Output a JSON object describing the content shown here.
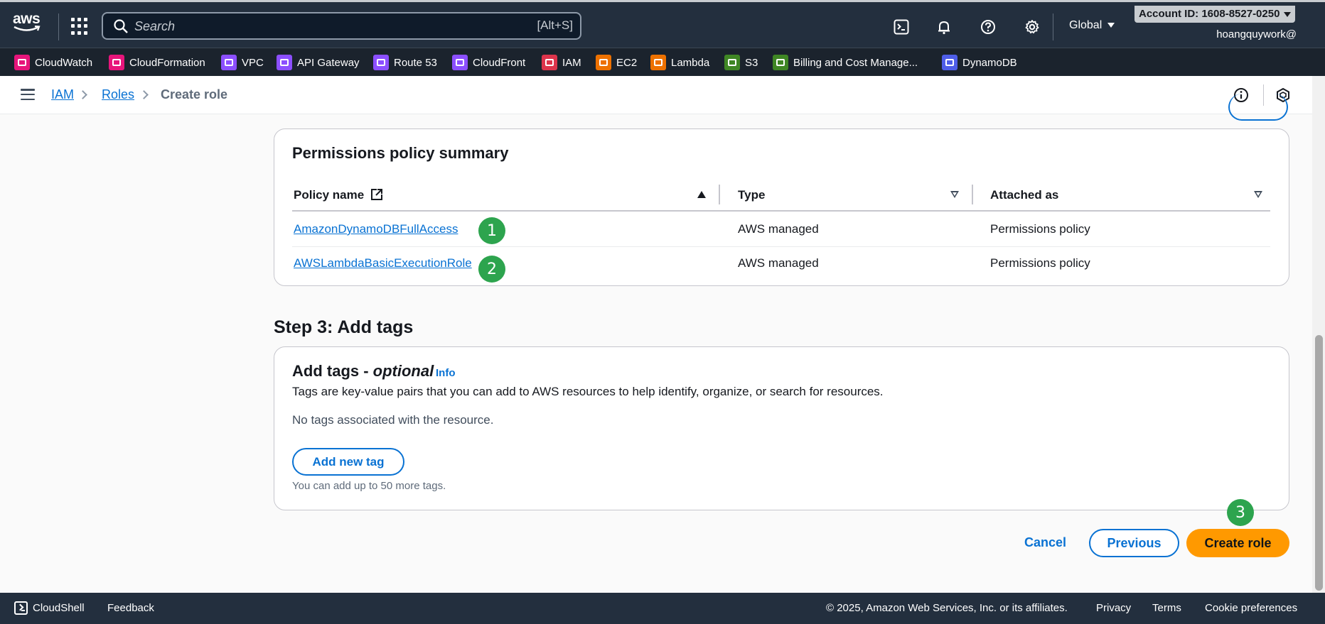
{
  "topnav": {
    "search_placeholder": "Search",
    "search_shortcut": "[Alt+S]",
    "region": "Global",
    "account": "Account ID: 1608-8527-0250",
    "username": "hoangquywork@"
  },
  "favorites": [
    {
      "label": "CloudWatch",
      "color": "#e7157b"
    },
    {
      "label": "CloudFormation",
      "color": "#e7157b"
    },
    {
      "label": "VPC",
      "color": "#8c4fff"
    },
    {
      "label": "API Gateway",
      "color": "#8c4fff"
    },
    {
      "label": "Route 53",
      "color": "#8c4fff"
    },
    {
      "label": "CloudFront",
      "color": "#8c4fff"
    },
    {
      "label": "IAM",
      "color": "#dd344c"
    },
    {
      "label": "EC2",
      "color": "#ed7100"
    },
    {
      "label": "Lambda",
      "color": "#ed7100"
    },
    {
      "label": "S3",
      "color": "#3f8624"
    },
    {
      "label": "Billing and Cost Manage...",
      "color": "#3f8624"
    },
    {
      "label": "DynamoDB",
      "color": "#4f5ee8"
    }
  ],
  "breadcrumb": {
    "items": [
      "IAM",
      "Roles"
    ],
    "current": "Create role"
  },
  "permissions": {
    "title": "Permissions policy summary",
    "columns": [
      "Policy name",
      "Type",
      "Attached as"
    ],
    "rows": [
      {
        "name": "AmazonDynamoDBFullAccess",
        "type": "AWS managed",
        "attached": "Permissions policy",
        "marker": "1"
      },
      {
        "name": "AWSLambdaBasicExecutionRole",
        "type": "AWS managed",
        "attached": "Permissions policy",
        "marker": "2"
      }
    ]
  },
  "step3": {
    "title": "Step 3: Add tags",
    "card_title": "Add tags - ",
    "card_title_em": "optional",
    "info": "Info",
    "description": "Tags are key-value pairs that you can add to AWS resources to help identify, organize, or search for resources.",
    "empty": "No tags associated with the resource.",
    "add_button": "Add new tag",
    "hint": "You can add up to 50 more tags."
  },
  "actions": {
    "cancel": "Cancel",
    "previous": "Previous",
    "create": "Create role",
    "marker": "3"
  },
  "footer": {
    "cloudshell": "CloudShell",
    "feedback": "Feedback",
    "copyright": "© 2025, Amazon Web Services, Inc. or its affiliates.",
    "privacy": "Privacy",
    "terms": "Terms",
    "cookies": "Cookie preferences"
  },
  "colors": {
    "link": "#0972d3",
    "primary": "#ff9900",
    "marker": "#2da44e",
    "nav_bg": "#232f3e"
  }
}
